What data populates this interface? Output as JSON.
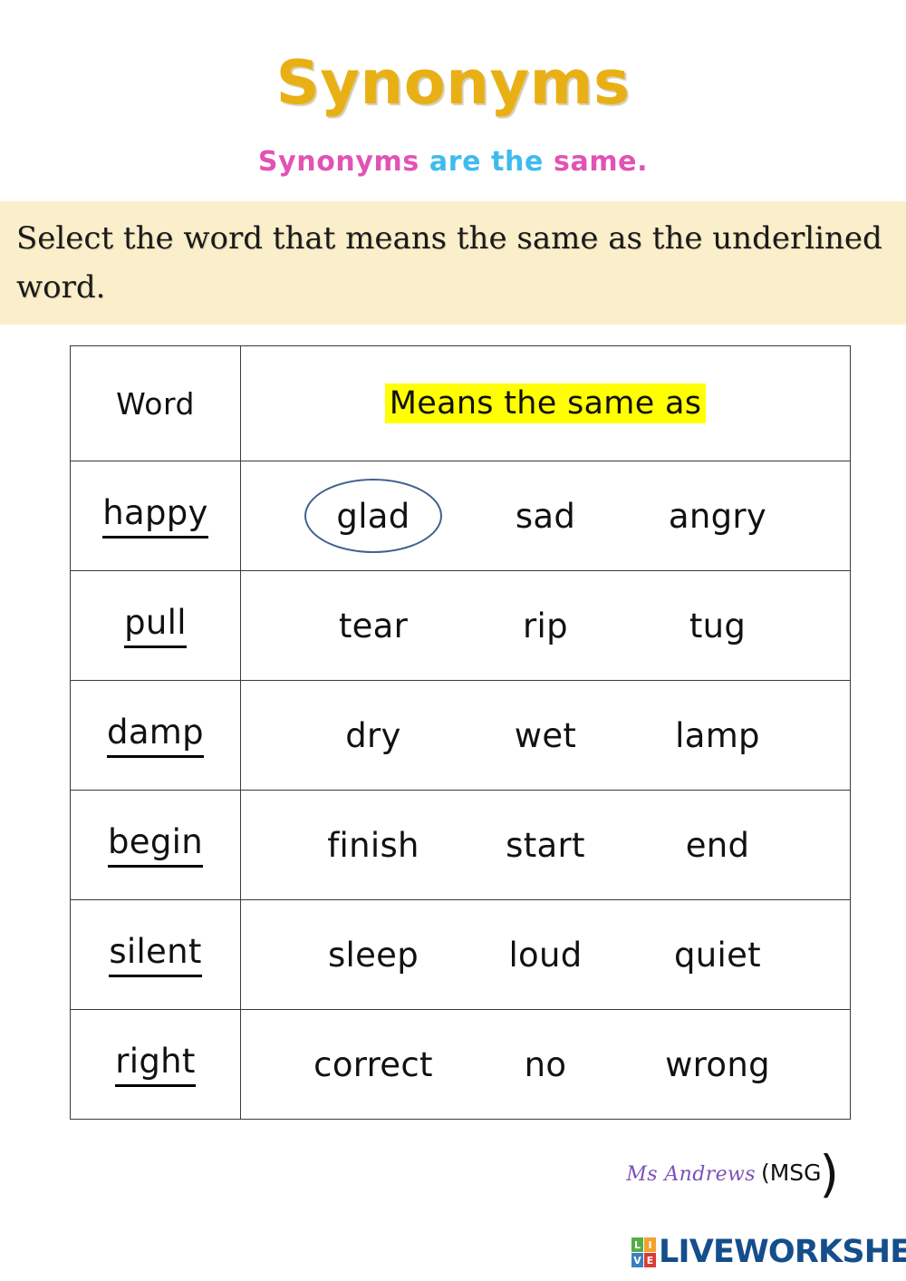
{
  "page": {
    "title": "Synonyms",
    "subtitle": {
      "part1": "Synonyms ",
      "part2": "are the ",
      "part3": "same.",
      "color_part1": "#E253B5",
      "color_part2": "#3FBBEE",
      "color_part3": "#E253B5"
    },
    "title_color": "#E8B014",
    "instruction": "Select the word that means the same as the underlined word.",
    "banner_color": "#FBEFCB"
  },
  "table": {
    "headers": {
      "word": "Word",
      "means": "Means the same as",
      "highlight_color": "#FFFF00"
    },
    "marker_color": "#41608F",
    "rows": [
      {
        "word": "happy",
        "options": [
          "glad",
          "sad",
          "angry"
        ],
        "marked_index": 0
      },
      {
        "word": "pull",
        "options": [
          "tear",
          "rip",
          "tug"
        ],
        "marked_index": -1
      },
      {
        "word": "damp",
        "options": [
          "dry",
          "wet",
          "lamp"
        ],
        "marked_index": -1
      },
      {
        "word": "begin",
        "options": [
          "finish",
          "start",
          "end"
        ],
        "marked_index": -1
      },
      {
        "word": "silent",
        "options": [
          "sleep",
          "loud",
          "quiet"
        ],
        "marked_index": -1
      },
      {
        "word": "right",
        "options": [
          "correct",
          "no",
          "wrong"
        ],
        "marked_index": -1
      }
    ]
  },
  "signature": {
    "name": "Ms Andrews",
    "initials": "(MSG",
    "paren": ")",
    "name_color": "#7B52B8"
  },
  "footer": {
    "logo_letters": [
      "L",
      "I",
      "V",
      "E"
    ],
    "logo_colors": [
      "#53AE4A",
      "#F0A22E",
      "#3C7EC1",
      "#DB3B35"
    ],
    "brand": "LIVEWORKSHEETS",
    "brand_color": "#144E8C"
  }
}
